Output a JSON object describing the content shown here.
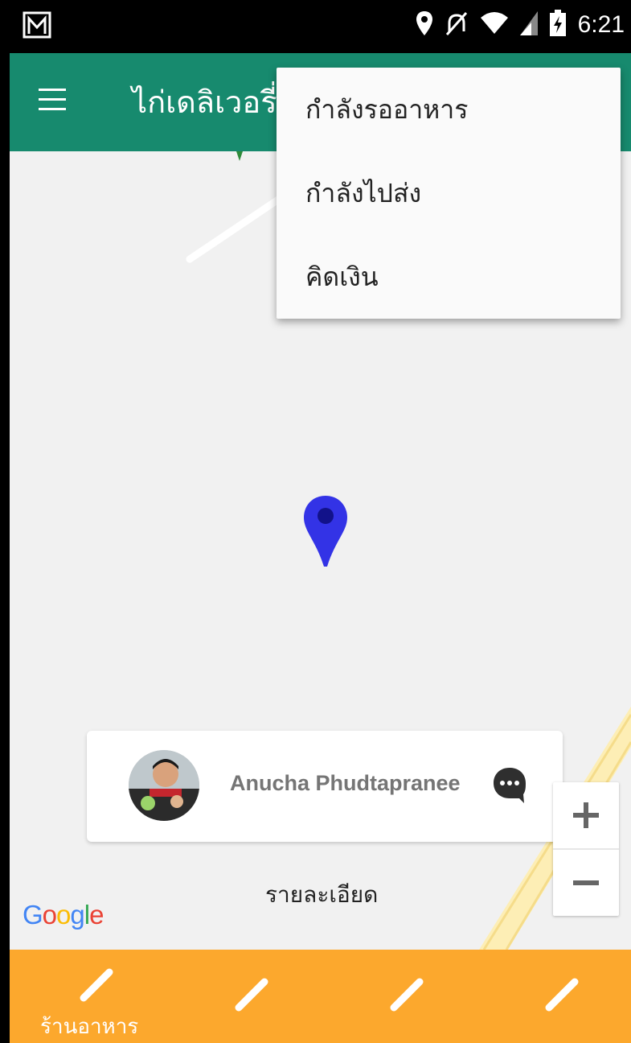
{
  "status_bar": {
    "time": "6:21",
    "icons": [
      "gmail-icon",
      "location-icon",
      "mute-icon",
      "wifi-icon",
      "signal-icon",
      "battery-charging-icon"
    ]
  },
  "app_bar": {
    "title": "ไก่เดลิเวอรี่",
    "color": "#178a6e",
    "icons": [
      "menu-icon"
    ]
  },
  "overflow_menu": {
    "items": [
      "กำลังรออาหาร",
      "กำลังไปส่ง",
      "คิดเงิน"
    ]
  },
  "map": {
    "marker": "map-pin-icon",
    "marker_color": "#3333e6",
    "google_logo": "Google",
    "zoom_in": "+",
    "zoom_out": "−"
  },
  "driver_card": {
    "name": "Anucha Phudtapranee",
    "icons": [
      "avatar",
      "chat-bubble-icon"
    ]
  },
  "details_label": "รายละเอียด",
  "bottom_nav": {
    "color": "#fca82d",
    "tabs": [
      {
        "label": "ร้านอาหาร",
        "icon": "pencil-icon"
      },
      {
        "label": "",
        "icon": "pencil-icon"
      },
      {
        "label": "",
        "icon": "pencil-icon"
      },
      {
        "label": "",
        "icon": "pencil-icon"
      }
    ]
  }
}
